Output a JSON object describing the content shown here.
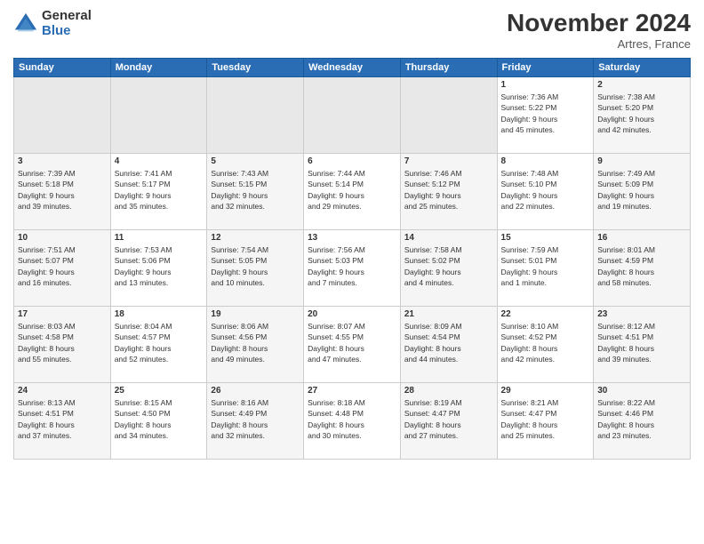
{
  "logo": {
    "general": "General",
    "blue": "Blue"
  },
  "title": "November 2024",
  "location": "Artres, France",
  "days_of_week": [
    "Sunday",
    "Monday",
    "Tuesday",
    "Wednesday",
    "Thursday",
    "Friday",
    "Saturday"
  ],
  "weeks": [
    [
      {
        "day": "",
        "info": ""
      },
      {
        "day": "",
        "info": ""
      },
      {
        "day": "",
        "info": ""
      },
      {
        "day": "",
        "info": ""
      },
      {
        "day": "",
        "info": ""
      },
      {
        "day": "1",
        "info": "Sunrise: 7:36 AM\nSunset: 5:22 PM\nDaylight: 9 hours\nand 45 minutes."
      },
      {
        "day": "2",
        "info": "Sunrise: 7:38 AM\nSunset: 5:20 PM\nDaylight: 9 hours\nand 42 minutes."
      }
    ],
    [
      {
        "day": "3",
        "info": "Sunrise: 7:39 AM\nSunset: 5:18 PM\nDaylight: 9 hours\nand 39 minutes."
      },
      {
        "day": "4",
        "info": "Sunrise: 7:41 AM\nSunset: 5:17 PM\nDaylight: 9 hours\nand 35 minutes."
      },
      {
        "day": "5",
        "info": "Sunrise: 7:43 AM\nSunset: 5:15 PM\nDaylight: 9 hours\nand 32 minutes."
      },
      {
        "day": "6",
        "info": "Sunrise: 7:44 AM\nSunset: 5:14 PM\nDaylight: 9 hours\nand 29 minutes."
      },
      {
        "day": "7",
        "info": "Sunrise: 7:46 AM\nSunset: 5:12 PM\nDaylight: 9 hours\nand 25 minutes."
      },
      {
        "day": "8",
        "info": "Sunrise: 7:48 AM\nSunset: 5:10 PM\nDaylight: 9 hours\nand 22 minutes."
      },
      {
        "day": "9",
        "info": "Sunrise: 7:49 AM\nSunset: 5:09 PM\nDaylight: 9 hours\nand 19 minutes."
      }
    ],
    [
      {
        "day": "10",
        "info": "Sunrise: 7:51 AM\nSunset: 5:07 PM\nDaylight: 9 hours\nand 16 minutes."
      },
      {
        "day": "11",
        "info": "Sunrise: 7:53 AM\nSunset: 5:06 PM\nDaylight: 9 hours\nand 13 minutes."
      },
      {
        "day": "12",
        "info": "Sunrise: 7:54 AM\nSunset: 5:05 PM\nDaylight: 9 hours\nand 10 minutes."
      },
      {
        "day": "13",
        "info": "Sunrise: 7:56 AM\nSunset: 5:03 PM\nDaylight: 9 hours\nand 7 minutes."
      },
      {
        "day": "14",
        "info": "Sunrise: 7:58 AM\nSunset: 5:02 PM\nDaylight: 9 hours\nand 4 minutes."
      },
      {
        "day": "15",
        "info": "Sunrise: 7:59 AM\nSunset: 5:01 PM\nDaylight: 9 hours\nand 1 minute."
      },
      {
        "day": "16",
        "info": "Sunrise: 8:01 AM\nSunset: 4:59 PM\nDaylight: 8 hours\nand 58 minutes."
      }
    ],
    [
      {
        "day": "17",
        "info": "Sunrise: 8:03 AM\nSunset: 4:58 PM\nDaylight: 8 hours\nand 55 minutes."
      },
      {
        "day": "18",
        "info": "Sunrise: 8:04 AM\nSunset: 4:57 PM\nDaylight: 8 hours\nand 52 minutes."
      },
      {
        "day": "19",
        "info": "Sunrise: 8:06 AM\nSunset: 4:56 PM\nDaylight: 8 hours\nand 49 minutes."
      },
      {
        "day": "20",
        "info": "Sunrise: 8:07 AM\nSunset: 4:55 PM\nDaylight: 8 hours\nand 47 minutes."
      },
      {
        "day": "21",
        "info": "Sunrise: 8:09 AM\nSunset: 4:54 PM\nDaylight: 8 hours\nand 44 minutes."
      },
      {
        "day": "22",
        "info": "Sunrise: 8:10 AM\nSunset: 4:52 PM\nDaylight: 8 hours\nand 42 minutes."
      },
      {
        "day": "23",
        "info": "Sunrise: 8:12 AM\nSunset: 4:51 PM\nDaylight: 8 hours\nand 39 minutes."
      }
    ],
    [
      {
        "day": "24",
        "info": "Sunrise: 8:13 AM\nSunset: 4:51 PM\nDaylight: 8 hours\nand 37 minutes."
      },
      {
        "day": "25",
        "info": "Sunrise: 8:15 AM\nSunset: 4:50 PM\nDaylight: 8 hours\nand 34 minutes."
      },
      {
        "day": "26",
        "info": "Sunrise: 8:16 AM\nSunset: 4:49 PM\nDaylight: 8 hours\nand 32 minutes."
      },
      {
        "day": "27",
        "info": "Sunrise: 8:18 AM\nSunset: 4:48 PM\nDaylight: 8 hours\nand 30 minutes."
      },
      {
        "day": "28",
        "info": "Sunrise: 8:19 AM\nSunset: 4:47 PM\nDaylight: 8 hours\nand 27 minutes."
      },
      {
        "day": "29",
        "info": "Sunrise: 8:21 AM\nSunset: 4:47 PM\nDaylight: 8 hours\nand 25 minutes."
      },
      {
        "day": "30",
        "info": "Sunrise: 8:22 AM\nSunset: 4:46 PM\nDaylight: 8 hours\nand 23 minutes."
      }
    ]
  ]
}
